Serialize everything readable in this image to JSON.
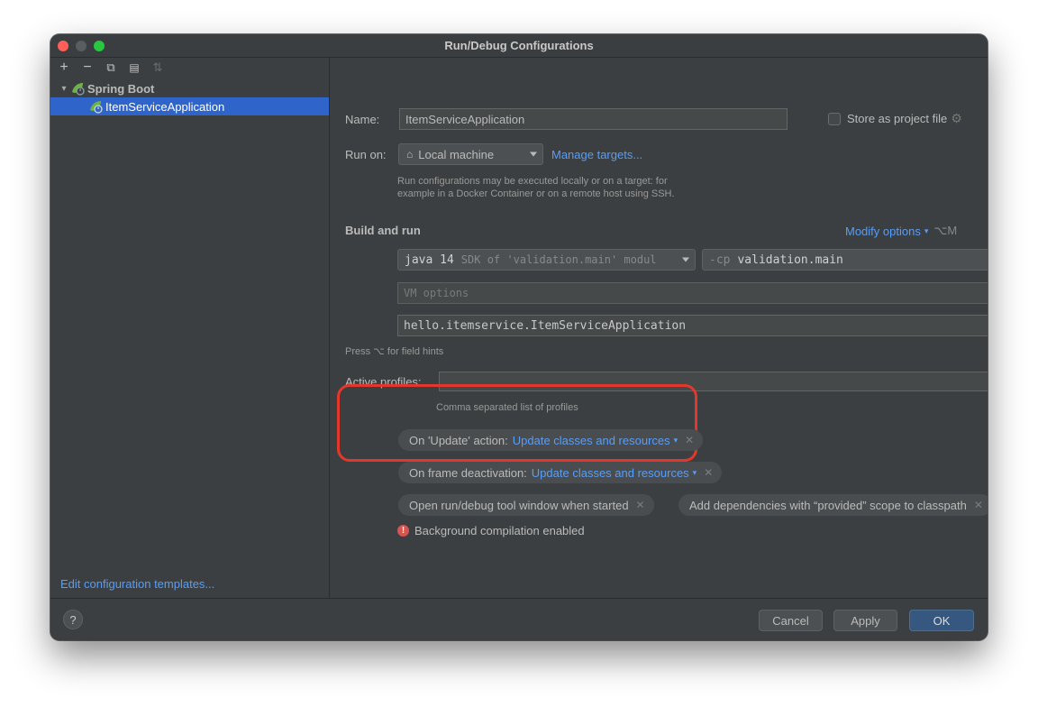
{
  "window": {
    "title": "Run/Debug Configurations"
  },
  "left": {
    "toolbar": [
      {
        "icon": "plus-icon",
        "glyph": "+"
      },
      {
        "icon": "minus-icon",
        "glyph": "−"
      },
      {
        "icon": "copy-icon",
        "glyph": "⧉"
      },
      {
        "icon": "folder-add-icon",
        "glyph": "▤"
      },
      {
        "icon": "sort-icon",
        "glyph": "⇅"
      }
    ],
    "tree": {
      "group_label": "Spring Boot",
      "item_label": "ItemServiceApplication"
    },
    "edit_templates": "Edit configuration templates..."
  },
  "form": {
    "name_label": "Name:",
    "name_value": "ItemServiceApplication",
    "store_label": "Store as project file",
    "run_on_label": "Run on:",
    "run_on_value": "Local machine",
    "manage_targets": "Manage targets...",
    "run_on_hint_1": "Run configurations may be executed locally or on a target: for",
    "run_on_hint_2": "example in a Docker Container or on a remote host using SSH.",
    "build_run_title": "Build and run",
    "modify_options": "Modify options",
    "modify_shortcut": "⌥M",
    "jdk_bold": "java 14",
    "jdk_rest": "SDK of 'validation.main' modul",
    "cp_prefix": "-cp",
    "cp_value": "validation.main",
    "vm_placeholder": "VM options",
    "main_class": "hello.itemservice.ItemServiceApplication",
    "field_hint": "Press ⌥ for field hints",
    "active_profiles_label": "Active profiles:",
    "active_profiles_value": "",
    "profiles_hint": "Comma separated list of profiles"
  },
  "options": {
    "update_action_label": "On 'Update' action:",
    "update_action_value": "Update classes and resources",
    "frame_deactivation_label": "On frame deactivation:",
    "frame_deactivation_value": "Update classes and resources",
    "open_tool_window": "Open run/debug tool window when started",
    "add_dependencies": "Add dependencies with “provided” scope to classpath",
    "background_compilation": "Background compilation enabled"
  },
  "buttons": {
    "help": "?",
    "cancel": "Cancel",
    "apply": "Apply",
    "ok": "OK"
  },
  "colors": {
    "accent_link": "#589df6",
    "selection": "#2f65ca",
    "highlight_border": "#e4372c",
    "primary_button": "#365880"
  }
}
